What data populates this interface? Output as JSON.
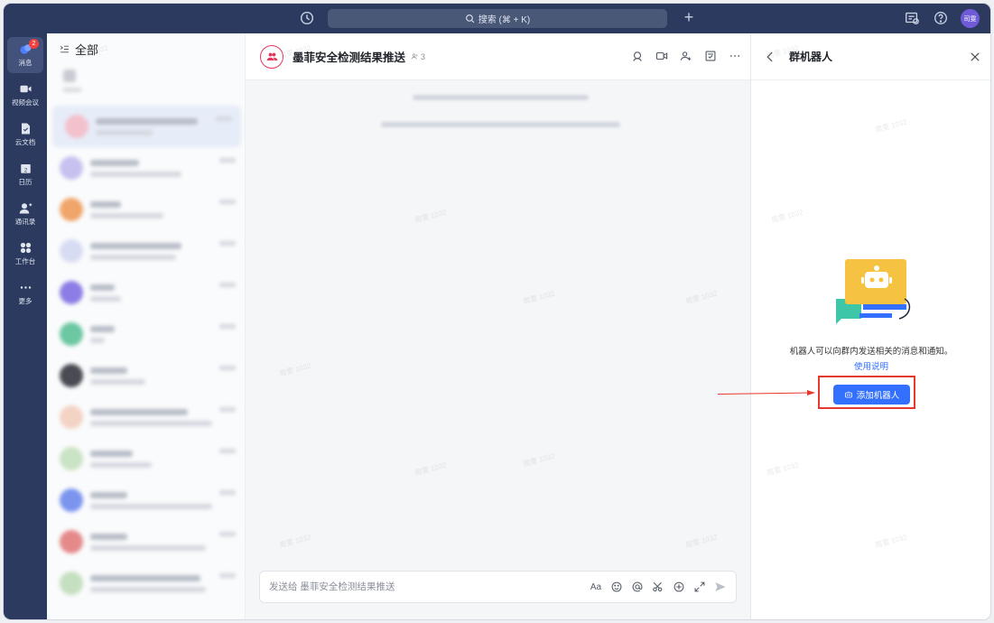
{
  "topbar": {
    "search_placeholder": "搜索 (⌘ + K)",
    "user_initials": "司雯"
  },
  "rail": {
    "unread_badge": "2",
    "items": [
      {
        "label": "消息"
      },
      {
        "label": "视频会议"
      },
      {
        "label": "云文档"
      },
      {
        "label": "日历"
      },
      {
        "label": "通讯录"
      },
      {
        "label": "工作台"
      },
      {
        "label": "更多"
      }
    ]
  },
  "chatlist": {
    "title": "全部"
  },
  "chat": {
    "group_name": "墨菲安全检测结果推送",
    "member_count": "3",
    "input_placeholder": "发送给 墨菲安全检测结果推送",
    "font_tool_label": "Aa"
  },
  "panel": {
    "title": "群机器人",
    "description": "机器人可以向群内发送相关的消息和通知。",
    "help_link": "使用说明",
    "add_button": "添加机器人"
  },
  "watermark": "周雯 1032",
  "colors": {
    "sidebar_bg": "#2b3a5e",
    "accent": "#3370ff",
    "highlight": "#e5382e",
    "badge": "#f04141"
  }
}
